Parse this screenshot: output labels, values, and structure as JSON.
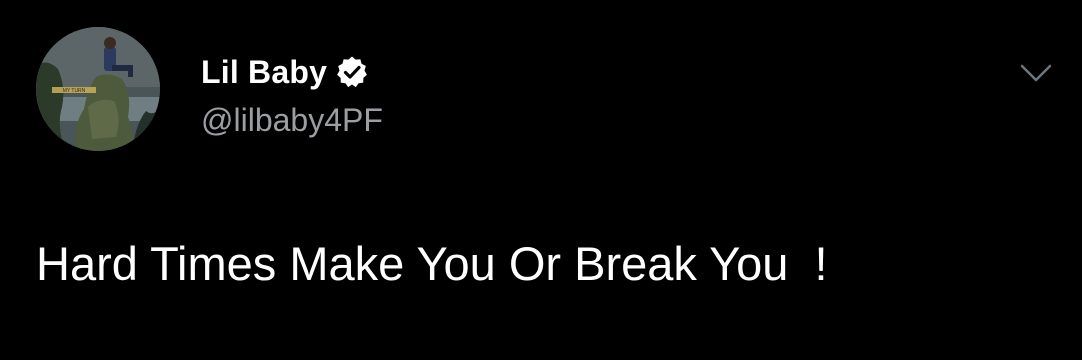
{
  "tweet": {
    "author": {
      "display_name": "Lil Baby",
      "handle": "@lilbaby4PF",
      "verified": true,
      "avatar_caption": "MY TURN"
    },
    "text": "Hard Times Make You Or Break You  !",
    "icons": {
      "verified": "verified-badge-icon",
      "menu": "chevron-down-icon"
    }
  },
  "colors": {
    "background": "#000000",
    "text": "#ffffff",
    "secondary_text": "#9b9fa3",
    "caret": "#6e767d"
  }
}
